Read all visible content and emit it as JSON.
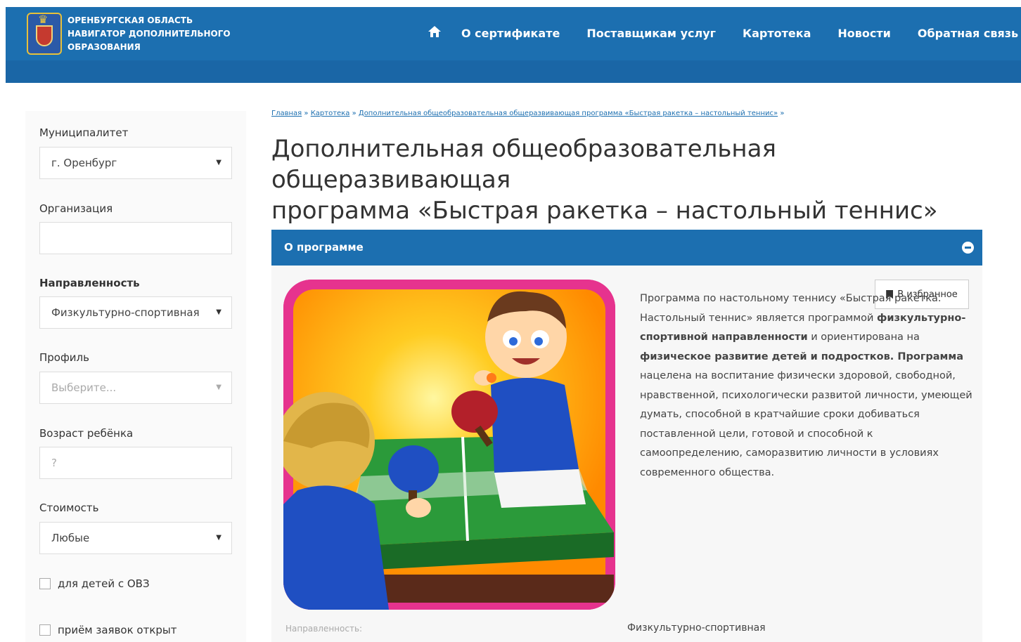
{
  "header": {
    "brand_line1": "ОРЕНБУРГСКАЯ ОБЛАСТЬ",
    "brand_line2": "НАВИГАТОР ДОПОЛНИТЕЛЬНОГО",
    "brand_line3": "ОБРАЗОВАНИЯ",
    "nav": {
      "home_icon": "home-icon",
      "certificate": "О сертификате",
      "providers": "Поставщикам услуг",
      "catalog": "Картотека",
      "news": "Новости",
      "feedback": "Обратная связь",
      "user_icon": "user-icon"
    },
    "colors": {
      "primary": "#1c6fb0"
    }
  },
  "sidebar": {
    "municipality_label": "Муниципалитет",
    "municipality_value": "г. Оренбург",
    "organization_label": "Организация",
    "organization_value": "",
    "direction_label": "Направленность",
    "direction_value": "Физкультурно-спортивная",
    "profile_label": "Профиль",
    "profile_placeholder": "Выберите...",
    "age_label": "Возраст ребёнка",
    "age_placeholder": "?",
    "cost_label": "Стоимость",
    "cost_value": "Любые",
    "ovz_checkbox": "для детей с ОВЗ",
    "open_checkbox": "приём заявок открыт"
  },
  "breadcrumb": {
    "home": "Главная",
    "catalog": "Картотека",
    "current": "Дополнительная общеобразовательная общеразвивающая программа «Быстрая ракетка – настольный теннис»",
    "sep": "»"
  },
  "page": {
    "title_line1": "Дополнительная общеобразовательная общеразвивающая",
    "title_line2": "программа «Быстрая ракетка – настольный теннис»"
  },
  "panel": {
    "title": "О программе",
    "favorite_label": "В избранное",
    "description": {
      "s1": "Программа по настольному теннису «Быстрая ракетка. Настольный теннис» является программой ",
      "b1": "физкультурно-спортивной направленности",
      "s2": " и ориентирована на ",
      "b2": "физическое развитие детей и подростков.",
      "b3": " Программа",
      "s3": " нацелена на воспитание физически здоровой, свободной, нравственной, психологически развитой личности, умеющей думать, способной в кратчайшие сроки добиваться поставленной цели, готовой и способной к самоопределению, саморазвитию личности в условиях современного общества."
    },
    "direction_label": "Направленность:",
    "direction_value": "Физкультурно-спортивная"
  }
}
